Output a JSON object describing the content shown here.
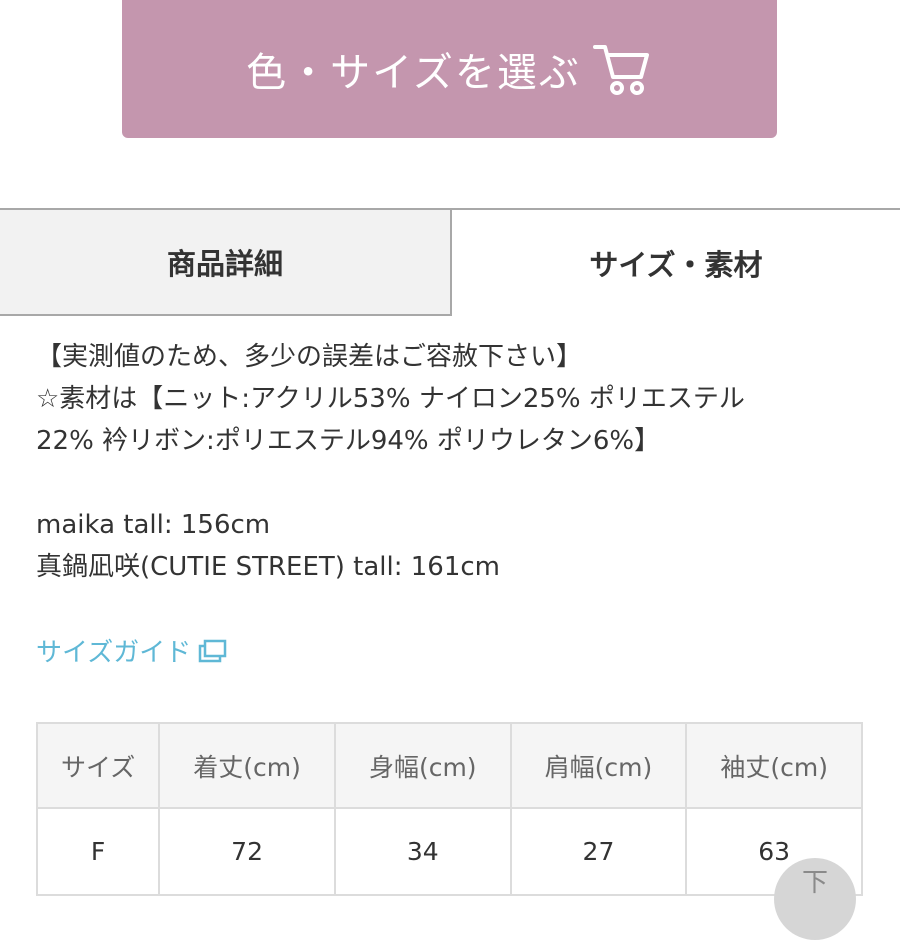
{
  "select_button": {
    "label": "色・サイズを選ぶ",
    "icon": "cart-icon"
  },
  "tabs": [
    {
      "label": "商品詳細",
      "active": false
    },
    {
      "label": "サイズ・素材",
      "active": true
    }
  ],
  "details": {
    "line1": "【実測値のため、多少の誤差はご容赦下さい】",
    "line2": "☆素材は【ニット:アクリル53% ナイロン25% ポリエステル",
    "line3": "22% 衿リボン:ポリエステル94% ポリウレタン6%】",
    "model1": "maika tall: 156cm",
    "model2": "真鍋凪咲(CUTIE STREET) tall: 161cm"
  },
  "size_guide": {
    "label": "サイズガイド",
    "icon": "external-link-icon",
    "color": "#5fb8d6"
  },
  "size_table": {
    "headers": [
      "サイズ",
      "着丈(cm)",
      "身幅(cm)",
      "肩幅(cm)",
      "袖丈(cm)"
    ],
    "rows": [
      [
        "F",
        "72",
        "34",
        "27",
        "63"
      ]
    ]
  },
  "scroll_button": {
    "label": "下"
  },
  "colors": {
    "button_bg": "#c496ae",
    "tab_inactive_bg": "#f2f2f2",
    "link": "#5fb8d6"
  }
}
